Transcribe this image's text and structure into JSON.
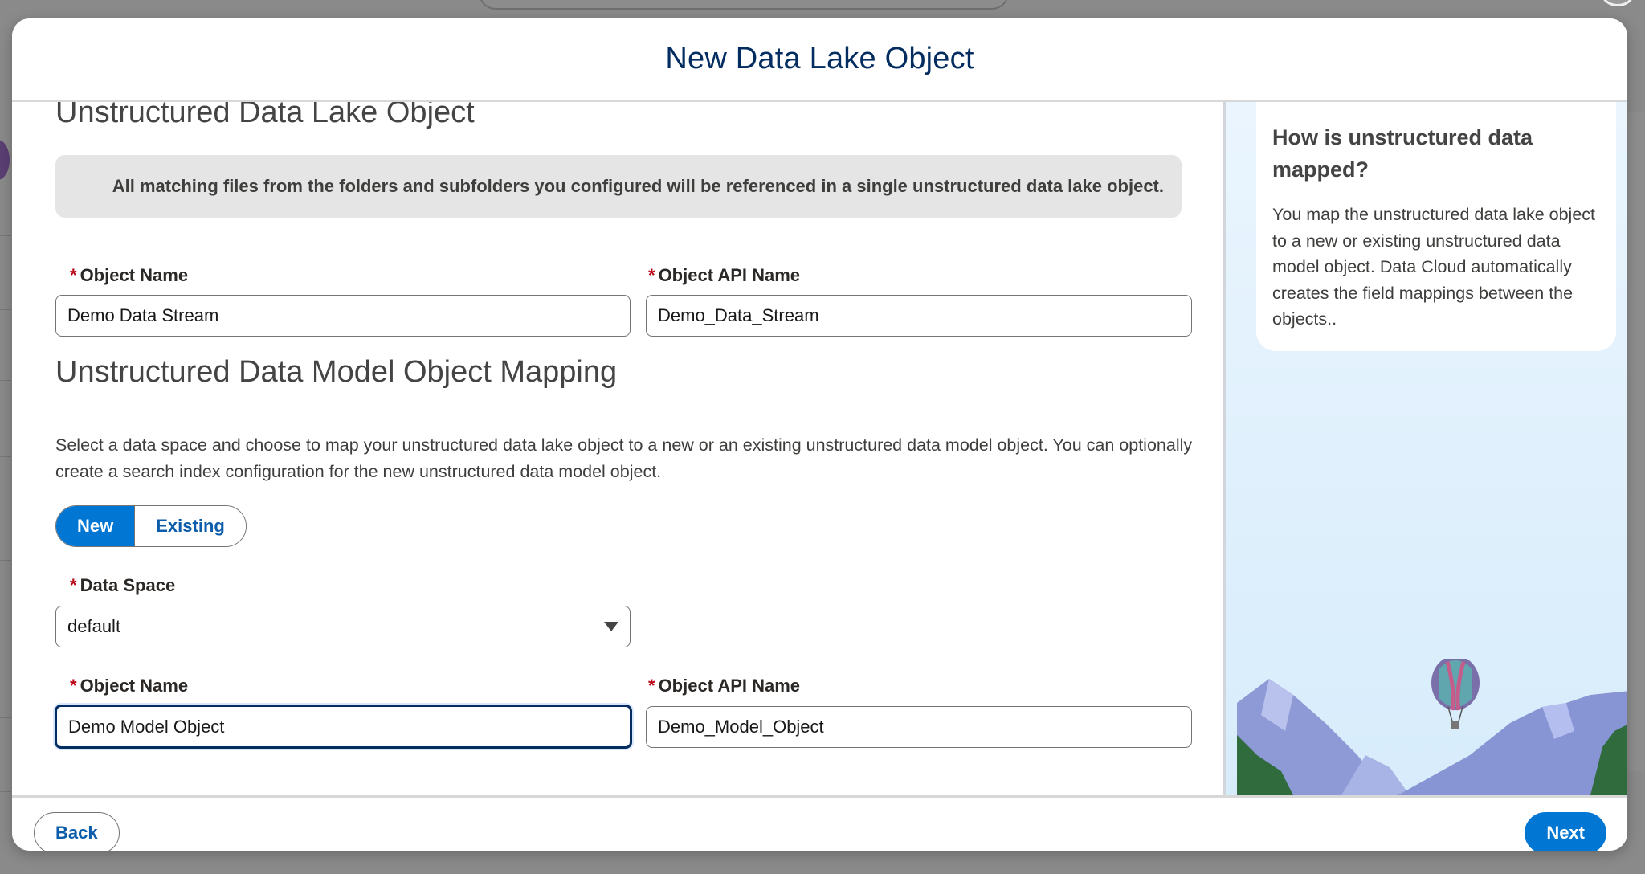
{
  "modal": {
    "title": "New Data Lake Object"
  },
  "section_dlo": {
    "title": "Unstructured Data Lake Object",
    "info": "All matching files from the folders and subfolders you configured will be referenced in a single unstructured data lake object.",
    "object_name_label": "Object Name",
    "object_name_value": "Demo Data Stream",
    "api_name_label": "Object API Name",
    "api_name_value": "Demo_Data_Stream"
  },
  "section_dmo": {
    "title": "Unstructured Data Model Object Mapping",
    "description": "Select a data space and choose to map your unstructured data lake object to a new or an existing unstructured data model object. You can optionally create a search index configuration for the new unstructured data model object.",
    "toggle": {
      "new_label": "New",
      "existing_label": "Existing",
      "selected": "New"
    },
    "data_space_label": "Data Space",
    "data_space_value": "default",
    "object_name_label": "Object Name",
    "object_name_value": "Demo Model Object",
    "api_name_label": "Object API Name",
    "api_name_value": "Demo_Model_Object"
  },
  "required_marker": "*",
  "help": {
    "title": "How is unstructured data mapped?",
    "body": "You map the unstructured data lake object to a new or existing unstructured data model object. Data Cloud automatically creates the field mappings between the objects.."
  },
  "footer": {
    "back_label": "Back",
    "next_label": "Next"
  },
  "colors": {
    "brand": "#0176d3",
    "title": "#032d60",
    "required": "#ba0517"
  }
}
